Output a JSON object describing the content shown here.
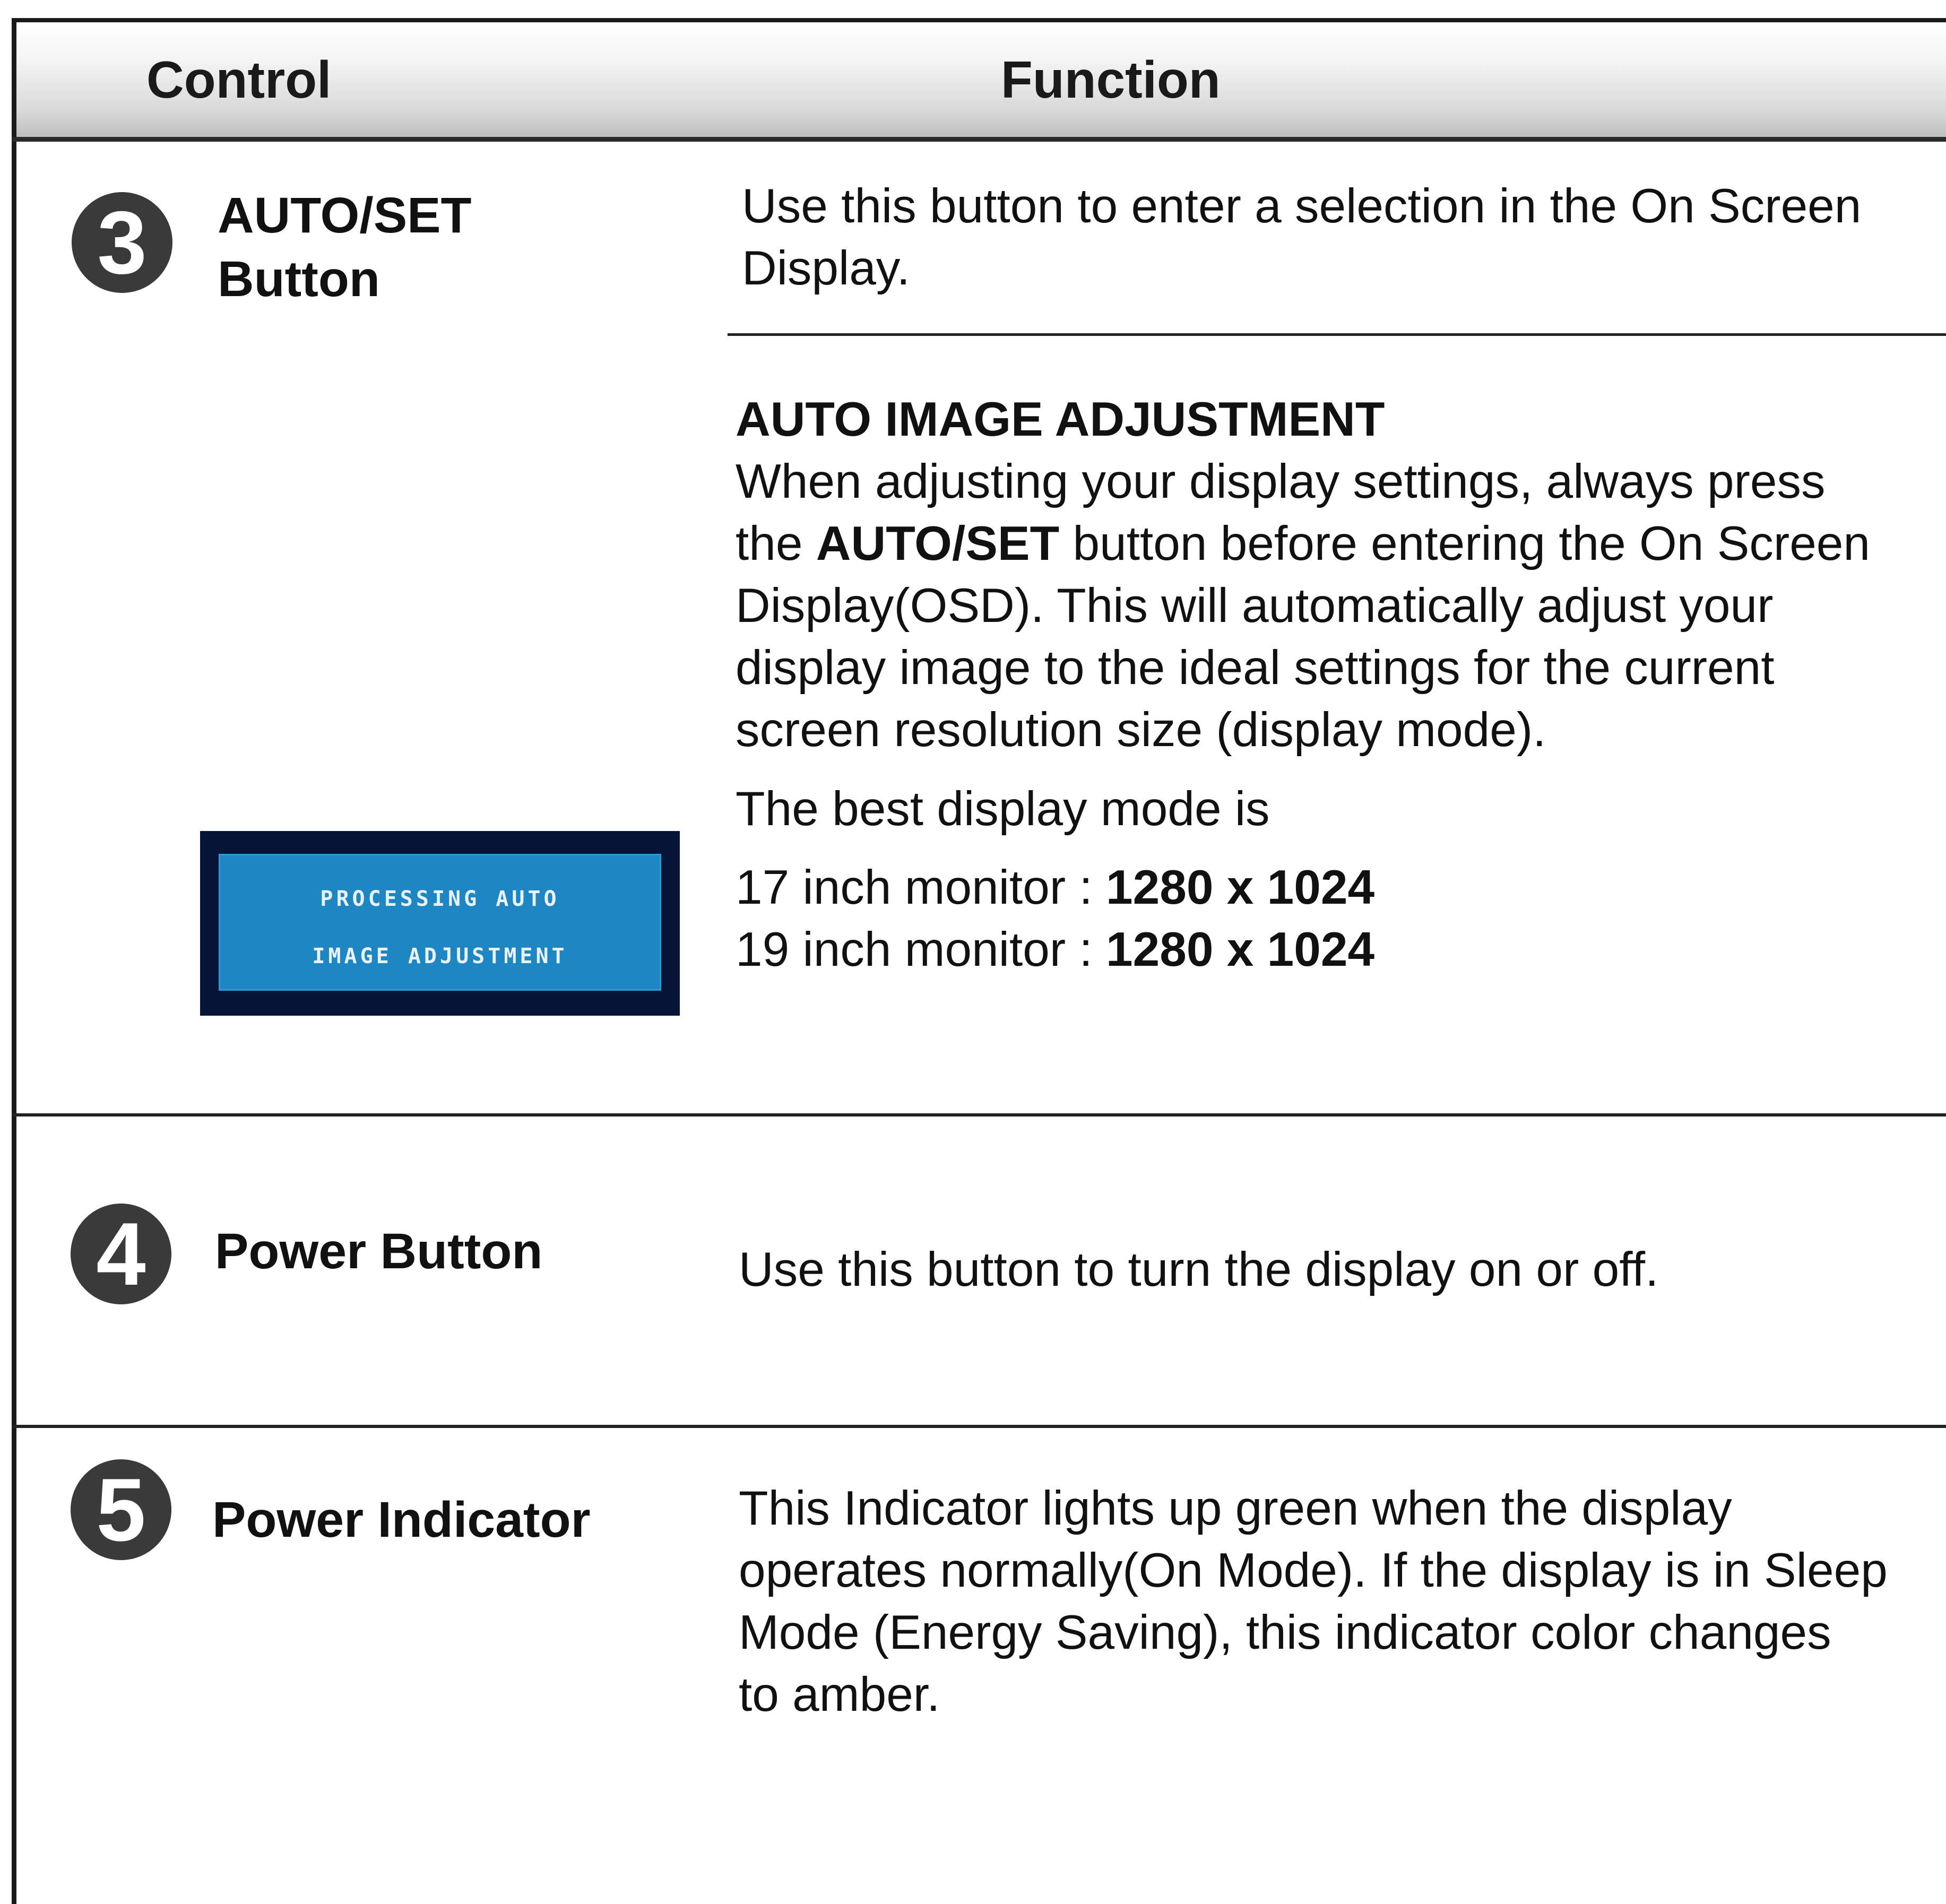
{
  "header": {
    "control": "Control",
    "function": "Function"
  },
  "rows": [
    {
      "number": "3",
      "icon": "number-3-circle-icon",
      "control": [
        "AUTO/SET",
        "Button"
      ],
      "function_top": [
        "Use this button to enter a selection in the On Screen",
        "Display."
      ],
      "auto_adjust": {
        "title": "AUTO IMAGE ADJUSTMENT",
        "line1": "When adjusting your display settings, always press",
        "line2_prefix": "the ",
        "line2_bold": "AUTO/SET",
        "line2_suffix": " button before entering the On Screen",
        "line3": "Display(OSD). This will automatically adjust your",
        "line4": "display image to the ideal settings for the current",
        "line5": "screen resolution size (display mode).",
        "best_mode": "The best display mode is",
        "modes": [
          {
            "label": "17 inch monitor : ",
            "value": "1280 x 1024"
          },
          {
            "label": "19 inch monitor : ",
            "value": "1280 x 1024"
          }
        ]
      },
      "osd": {
        "line1": "PROCESSING AUTO",
        "line2": "IMAGE ADJUSTMENT"
      }
    },
    {
      "number": "4",
      "icon": "number-4-circle-icon",
      "control": "Power Button",
      "function": "Use this button to turn the display on or off."
    },
    {
      "number": "5",
      "icon": "number-5-circle-icon",
      "control": "Power Indicator",
      "function": [
        "This Indicator lights up green when the display",
        "operates normally(On Mode). If the display is in Sleep",
        "Mode (Energy Saving), this indicator color changes",
        "to amber."
      ]
    }
  ],
  "colors": {
    "osd_border": "#041538",
    "osd_fill": "#1f86c4",
    "icon_fill": "#3a3a3a"
  }
}
